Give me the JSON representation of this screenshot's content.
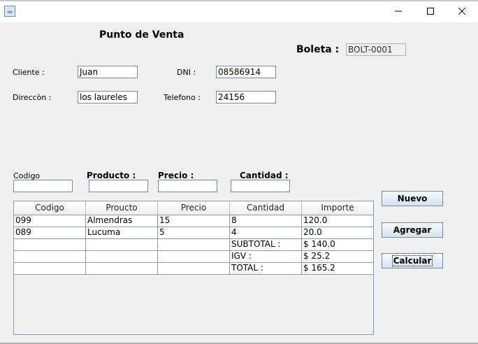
{
  "window": {
    "minimize": "—",
    "maximize": "☐",
    "close": "✕"
  },
  "header": {
    "title": "Punto de Venta",
    "boleta_label": "Boleta :",
    "boleta_value": "BOLT-0001"
  },
  "customer": {
    "cliente_label": "Cliente :",
    "cliente_value": "Juan",
    "dni_label": "DNI :",
    "dni_value": "08586914",
    "direccion_label": "Direccòn :",
    "direccion_value": "los laureles",
    "telefono_label": "Telefono :",
    "telefono_value": "24156"
  },
  "entry": {
    "codigo_label": "Codigo",
    "producto_label": "Producto :",
    "precio_label": "Precio :",
    "cantidad_label": "Cantidad :",
    "codigo_value": "",
    "producto_value": "",
    "precio_value": "",
    "cantidad_value": ""
  },
  "buttons": {
    "nuevo": "Nuevo",
    "agregar": "Agregar",
    "calcular": "Calcular"
  },
  "table": {
    "headers": [
      "Codigo",
      "Proucto",
      "Precio",
      "Cantidad",
      "Importe"
    ],
    "rows": [
      [
        "099",
        "Almendras",
        "15",
        "8",
        "120.0"
      ],
      [
        "089",
        "Lucuma",
        "5",
        "4",
        "20.0"
      ],
      [
        "",
        "",
        "",
        "SUBTOTAL :",
        "$ 140.0"
      ],
      [
        "",
        "",
        "",
        "IGV :",
        "$ 25.2"
      ],
      [
        "",
        "",
        "",
        "TOTAL  :",
        "$ 165.2"
      ]
    ]
  }
}
